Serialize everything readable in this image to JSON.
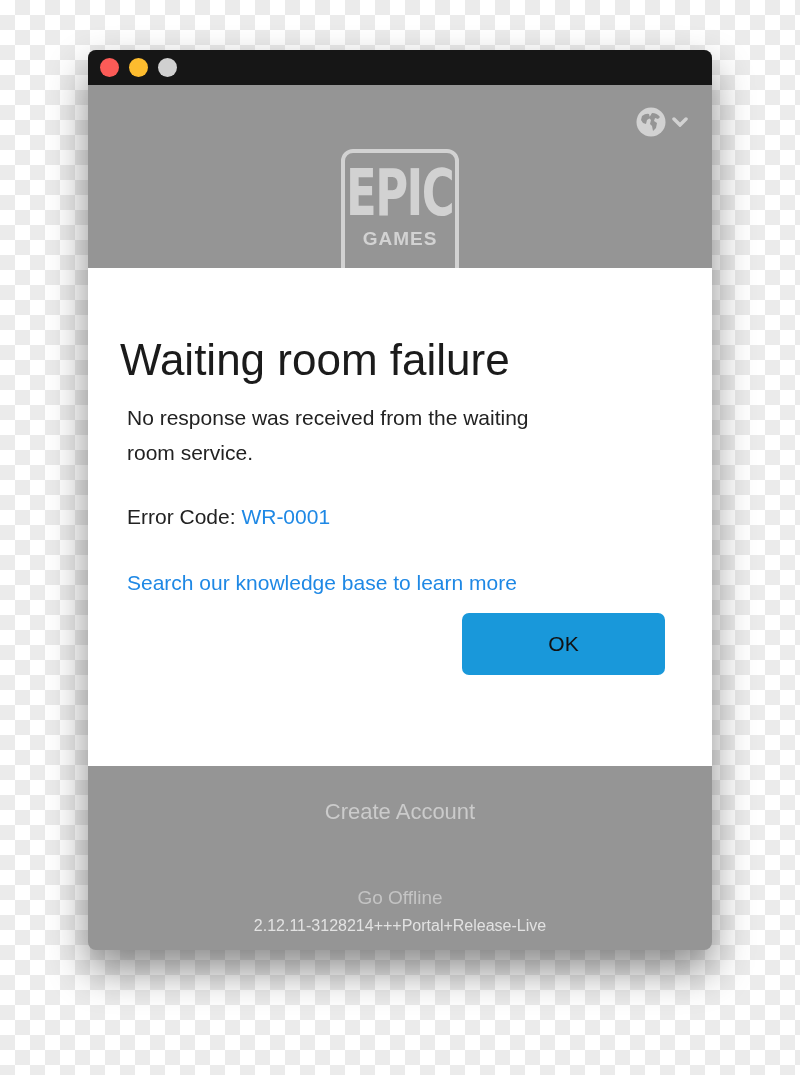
{
  "window": {
    "controls": [
      {
        "color": "#fc5b57"
      },
      {
        "color": "#fdbc2e"
      },
      {
        "color": "#d0d0d0"
      }
    ]
  },
  "logo": {
    "line_1": "EPIC",
    "line_2": "GAMES"
  },
  "dialog": {
    "title": "Waiting room failure",
    "message": "No response was received from the waiting room service.",
    "error_label": "Error Code:",
    "error_code": "WR-0001",
    "link": "Search our knowledge base to learn more",
    "button": "OK"
  },
  "footer": {
    "create_account": "Create Account",
    "go_offline": "Go Offline",
    "version": "2.12.11-3128214+++Portal+Release-Live"
  }
}
